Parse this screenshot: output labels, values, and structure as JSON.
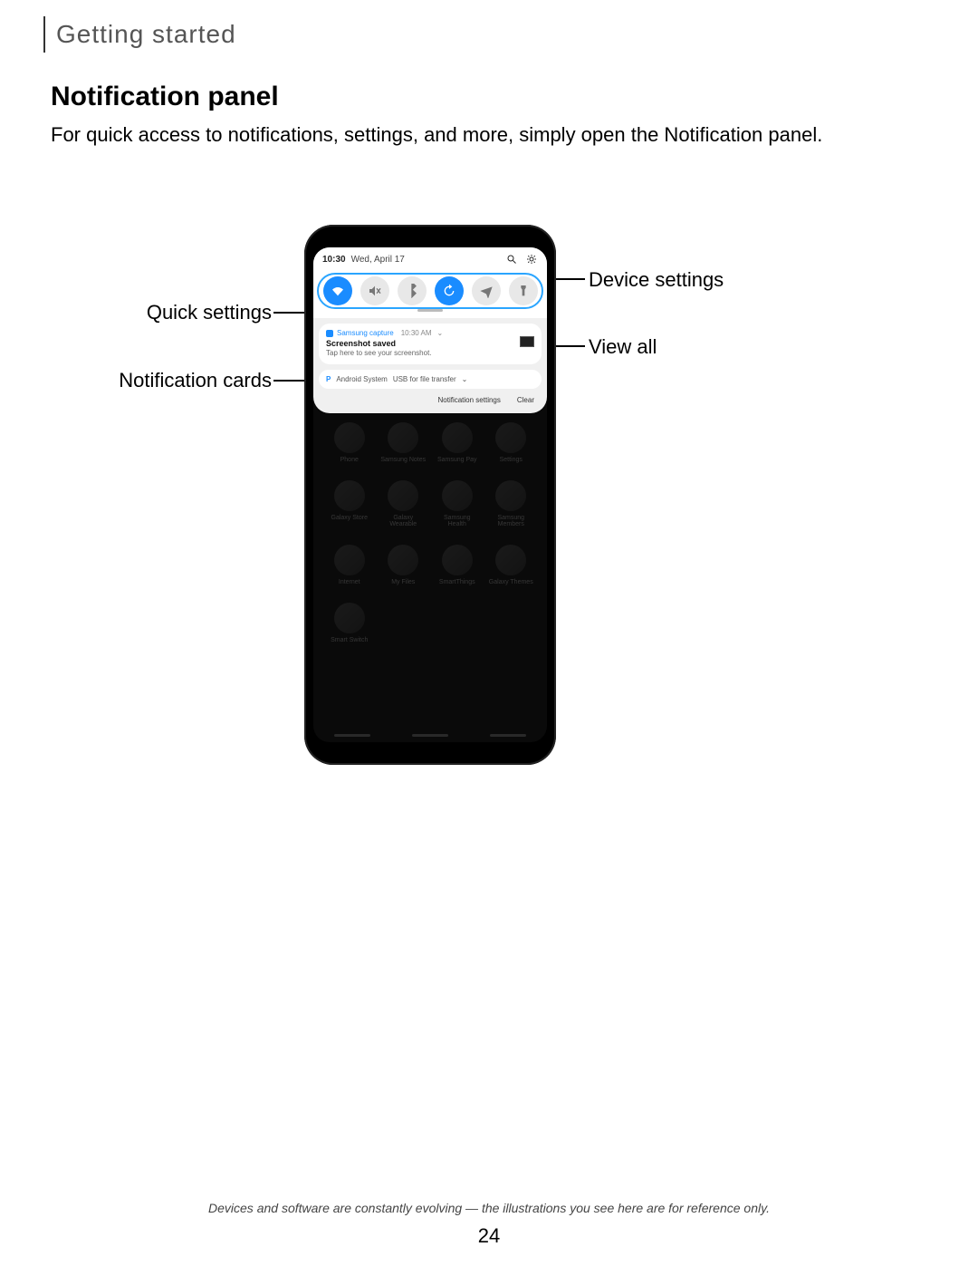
{
  "breadcrumb": "Getting started",
  "title": "Notification panel",
  "intro": "For quick access to notifications, settings, and more, simply open the Notification panel.",
  "callouts": {
    "quick_settings": "Quick settings",
    "notification_cards": "Notification cards",
    "device_settings": "Device settings",
    "view_all": "View all"
  },
  "status": {
    "time": "10:30",
    "date": "Wed, April 17"
  },
  "notif1": {
    "app": "Samsung capture",
    "time": "10:30 AM",
    "title": "Screenshot saved",
    "sub": "Tap here to see your screenshot."
  },
  "notif2": {
    "app": "Android System",
    "text": "USB for file transfer"
  },
  "panel_footer": {
    "settings": "Notification settings",
    "clear": "Clear"
  },
  "apps": [
    "Phone",
    "Samsung Notes",
    "Samsung Pay",
    "Settings",
    "Galaxy Store",
    "Galaxy Wearable",
    "Samsung Health",
    "Samsung Members",
    "Internet",
    "My Files",
    "SmartThings",
    "Galaxy Themes",
    "Smart Switch"
  ],
  "footer": "Devices and software are constantly evolving — the illustrations you see here are for reference only.",
  "page_number": "24"
}
